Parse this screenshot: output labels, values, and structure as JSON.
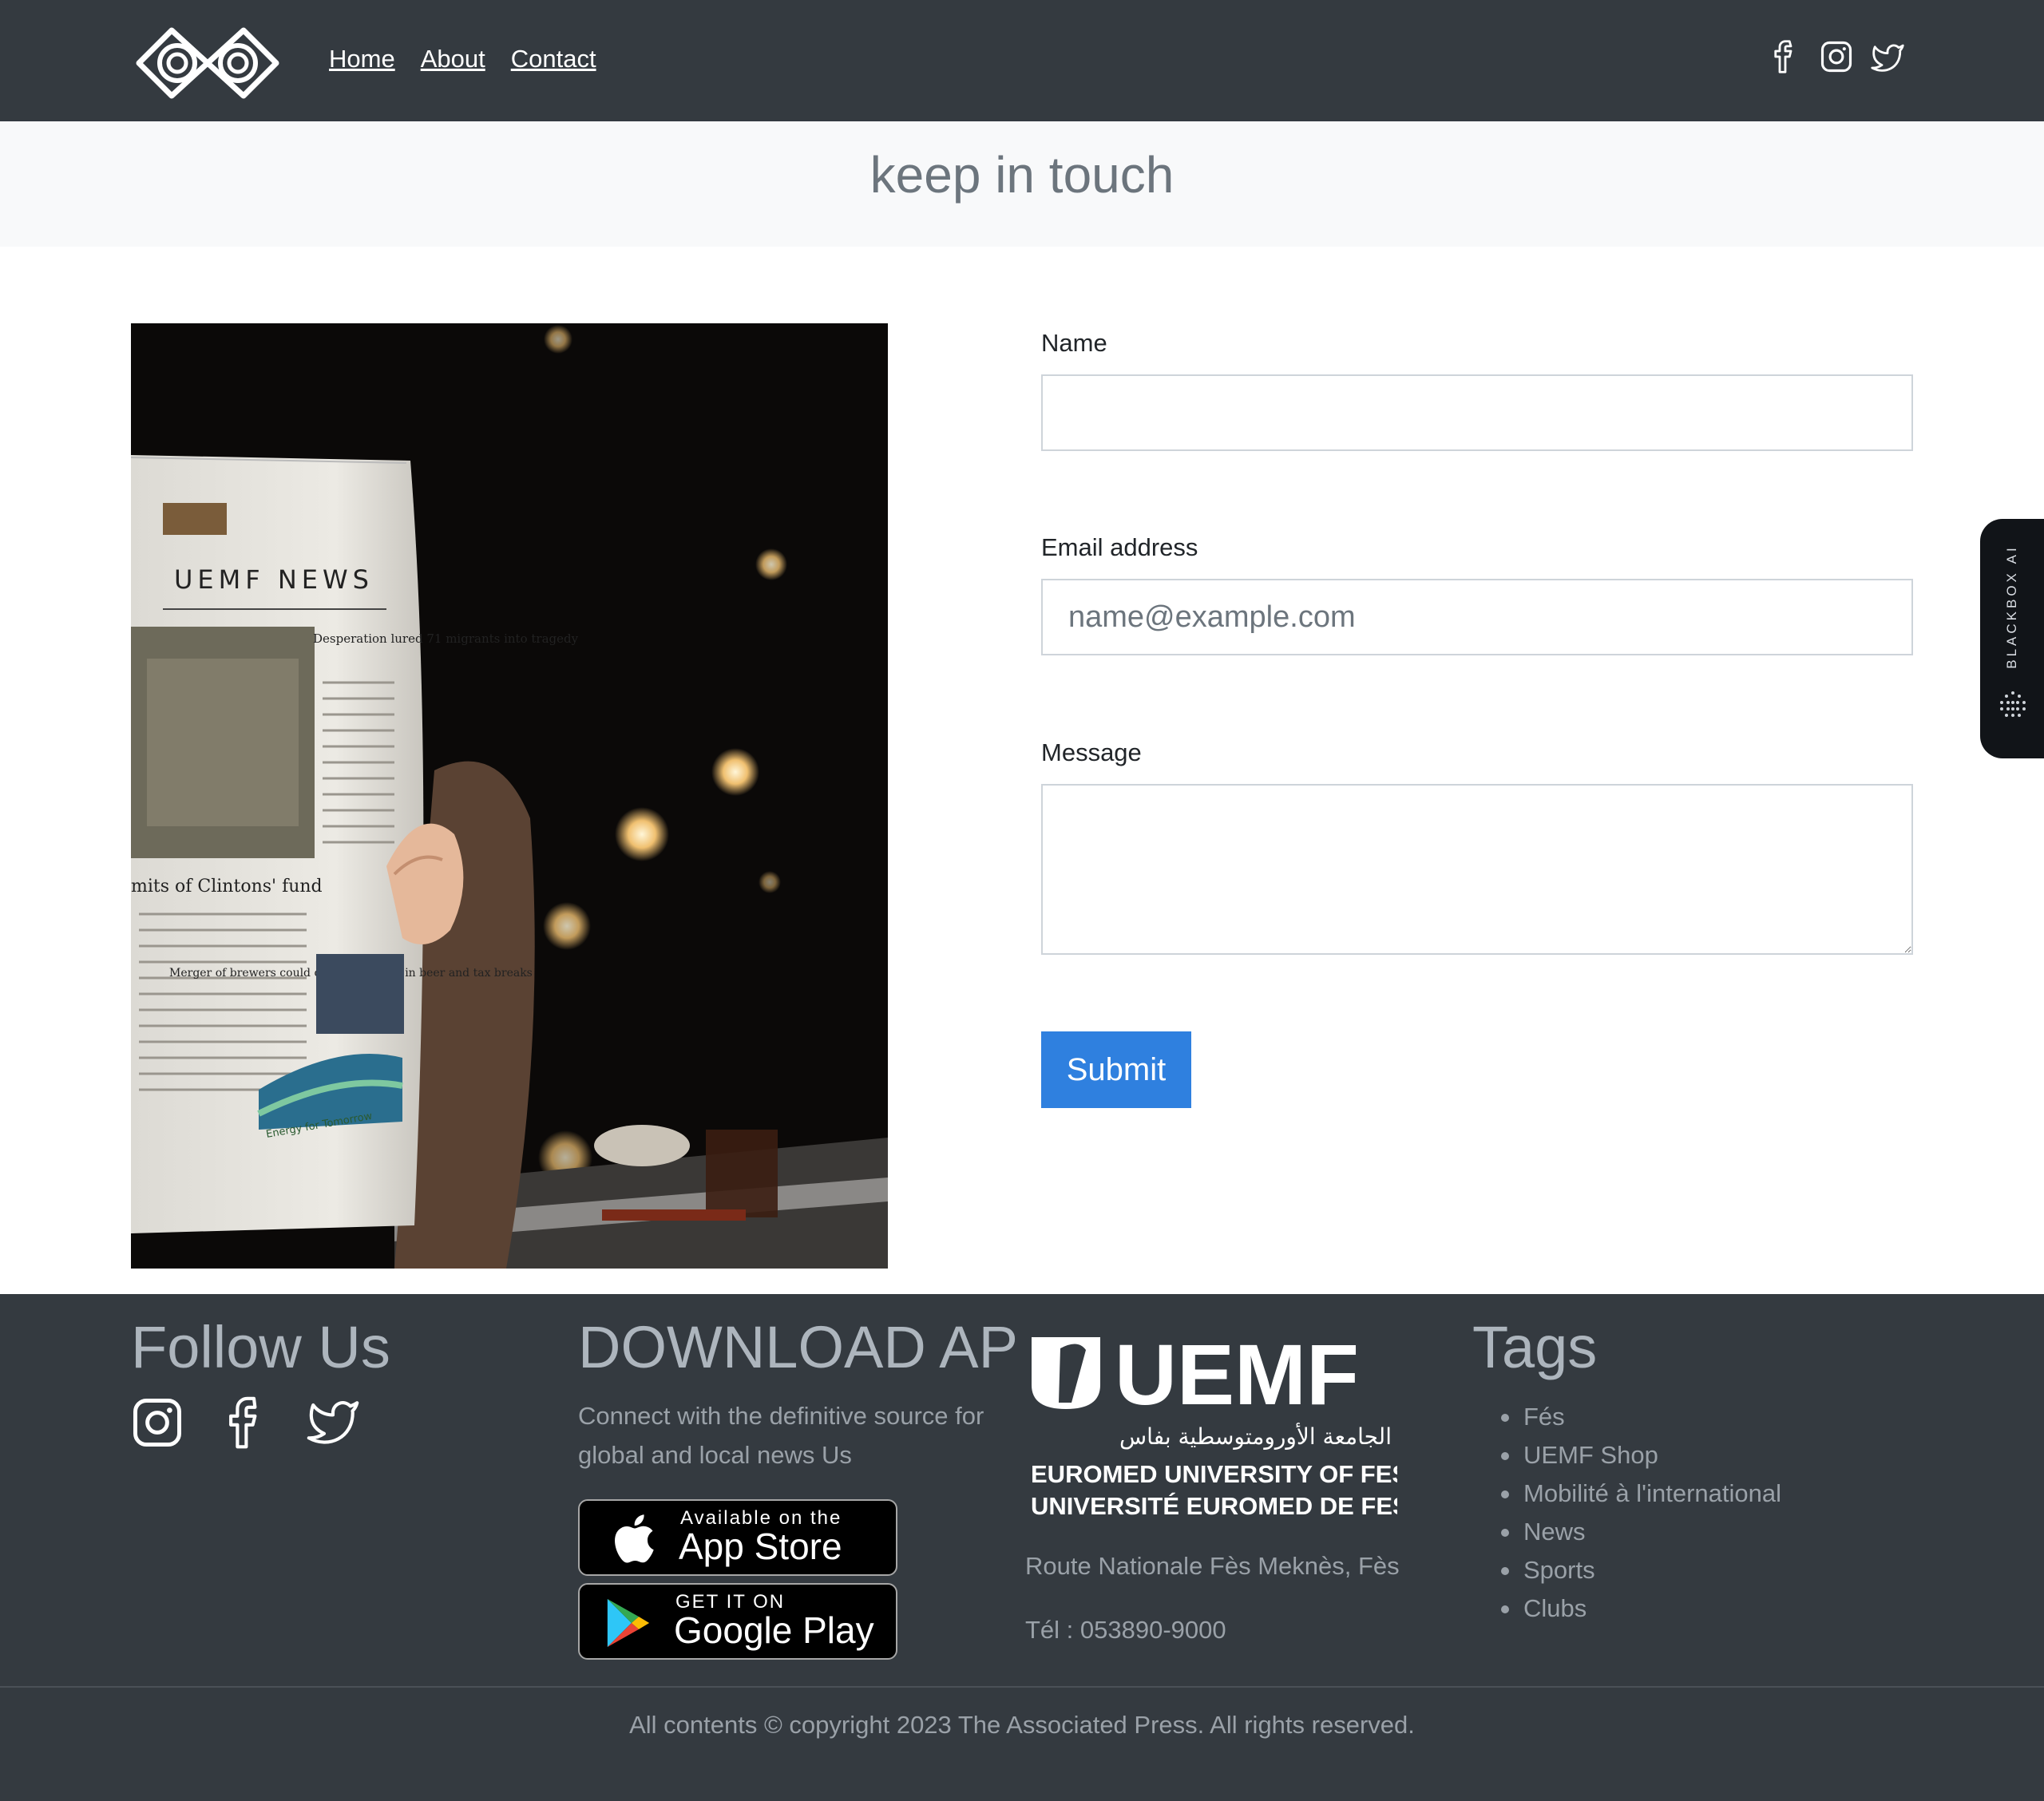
{
  "nav": {
    "links": [
      "Home",
      "About",
      "Contact"
    ],
    "social_icons": [
      "facebook-icon",
      "instagram-icon",
      "twitter-icon"
    ]
  },
  "page_title": "keep in touch",
  "photo": {
    "newspaper_masthead": "UEMF NEWS",
    "headlines": [
      "Desperation lured 71 migrants into tragedy",
      "mits of Clintons' fund",
      "Merger of brewers could create colossus in beer and tax breaks",
      "Energy for Tomorrow"
    ]
  },
  "form": {
    "name_label": "Name",
    "name_value": "",
    "email_label": "Email address",
    "email_placeholder": "name@example.com",
    "message_label": "Message",
    "message_value": "",
    "submit_label": "Submit"
  },
  "side_widget": {
    "label": "BLACKBOX AI"
  },
  "footer": {
    "follow": {
      "heading": "Follow Us",
      "icons": [
        "instagram-icon",
        "facebook-icon",
        "twitter-icon"
      ]
    },
    "download": {
      "heading": "DOWNLOAD AP",
      "text": "Connect with the definitive source for global and local news Us",
      "app_store": {
        "small": "Available on the",
        "big": "App Store"
      },
      "google_play": {
        "small": "GET IT ON",
        "big": "Google Play"
      }
    },
    "university": {
      "logo_text": "UEMF",
      "arabic_name": "الجامعة الأورومتوسطية بفاس",
      "name_en": "EUROMED UNIVERSITY OF FES",
      "name_fr": "UNIVERSITÉ EUROMED DE FES",
      "address": "Route Nationale Fès Meknès, Fès",
      "phone": "Tél : 053890-9000"
    },
    "tags": {
      "heading": "Tags",
      "items": [
        "Fés",
        "UEMF Shop",
        "Mobilité à l'international",
        "News",
        "Sports",
        "Clubs"
      ]
    },
    "copyright": "All contents © copyright 2023 The Associated Press. All rights reserved."
  }
}
